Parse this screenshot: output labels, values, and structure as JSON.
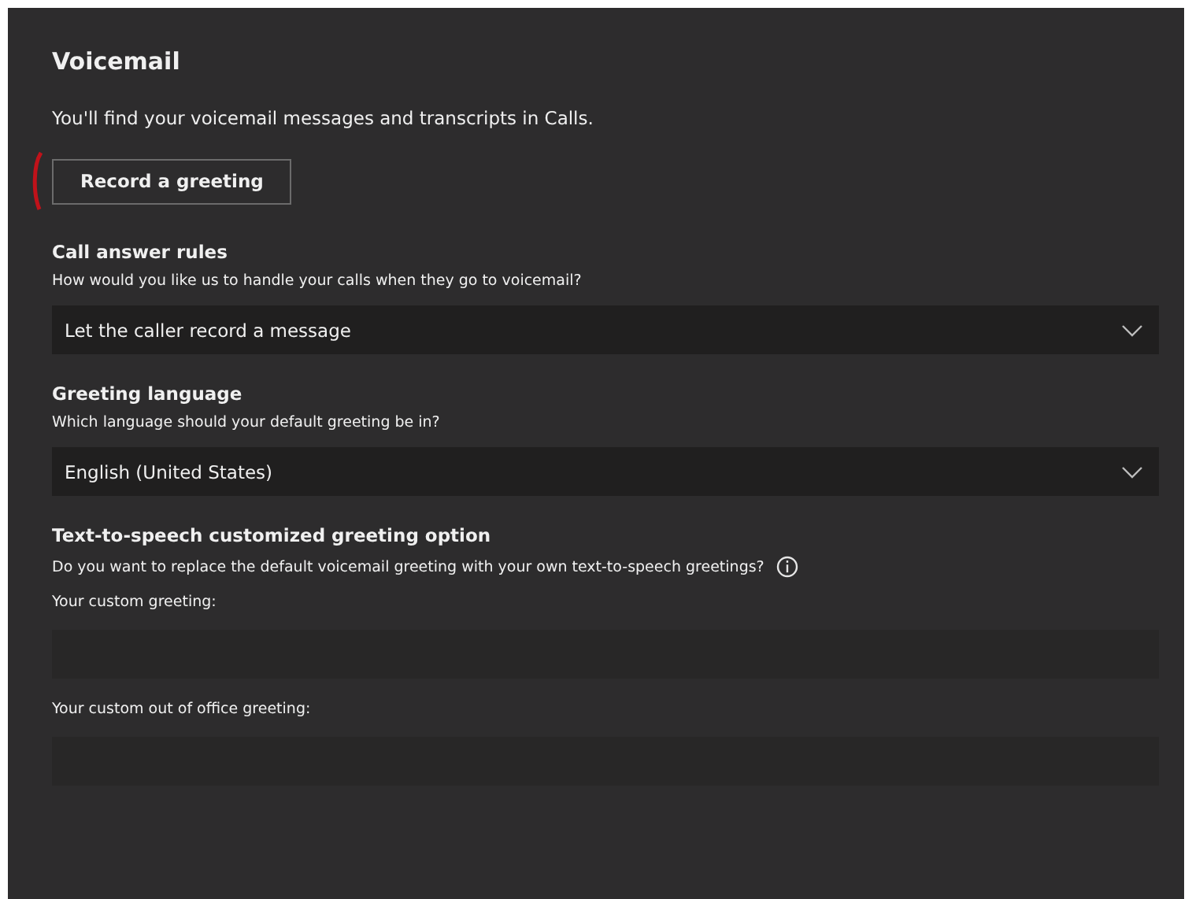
{
  "title": "Voicemail",
  "intro": "You'll find your voicemail messages and transcripts in Calls.",
  "record_button": "Record a greeting",
  "sections": [
    {
      "kind": "dropdown",
      "heading": "Call answer rules",
      "description": "How would you like us to handle your calls when they go to voicemail?",
      "value": "Let the caller record a message"
    },
    {
      "kind": "dropdown",
      "heading": "Greeting language",
      "description": "Which language should your default greeting be in?",
      "value": "English (United States)"
    },
    {
      "kind": "fields",
      "heading": "Text-to-speech customized greeting option",
      "description": "Do you want to replace the default voicemail greeting with your own text-to-speech greetings?",
      "info": true,
      "fields": [
        {
          "label": "Your custom greeting:"
        },
        {
          "label": "Your custom out of office greeting:"
        }
      ]
    }
  ]
}
